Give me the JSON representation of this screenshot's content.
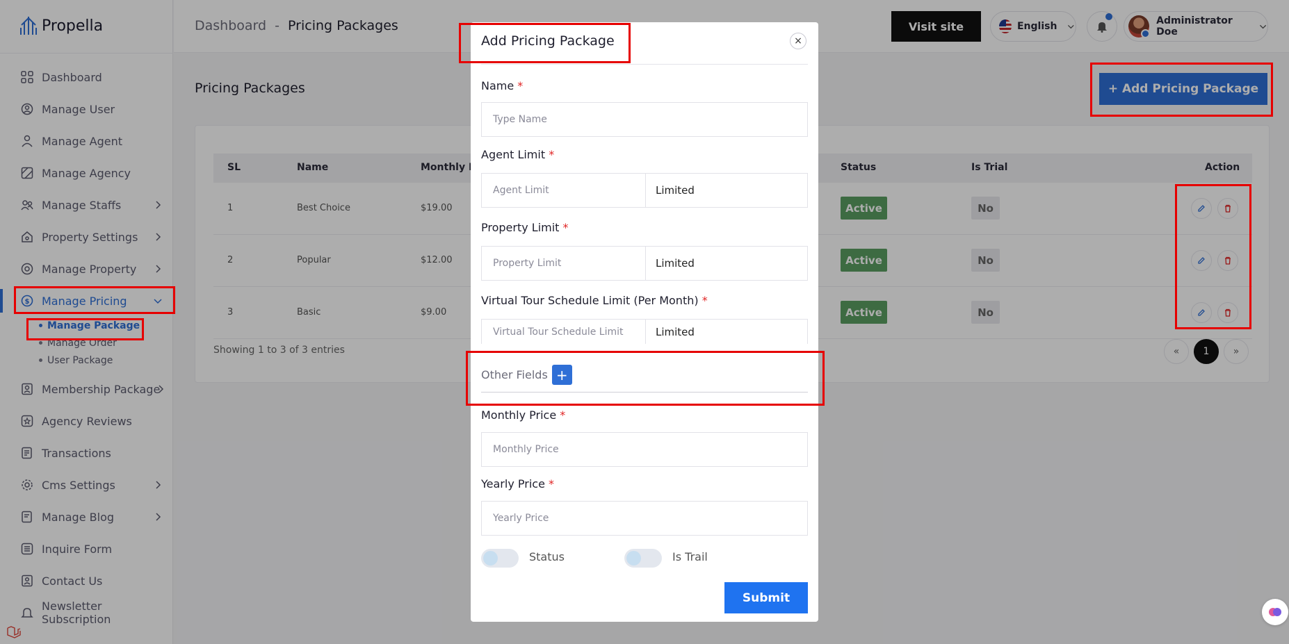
{
  "brand": {
    "name": "Propella"
  },
  "sidebar": {
    "items": [
      {
        "label": "Dashboard",
        "icon": "grid-icon"
      },
      {
        "label": "Manage User",
        "icon": "user-circle-icon"
      },
      {
        "label": "Manage Agent",
        "icon": "agent-icon"
      },
      {
        "label": "Manage Agency",
        "icon": "agency-icon"
      },
      {
        "label": "Manage Staffs",
        "icon": "staff-icon",
        "has_children": true
      },
      {
        "label": "Property Settings",
        "icon": "home-settings-icon",
        "has_children": true
      },
      {
        "label": "Manage Property",
        "icon": "property-icon",
        "has_children": true
      },
      {
        "label": "Manage Pricing",
        "icon": "pricing-icon",
        "has_children": true,
        "expanded": true
      }
    ],
    "pricing_sub": [
      {
        "label": "Manage Package"
      },
      {
        "label": "Manage Order"
      },
      {
        "label": "User Package"
      }
    ],
    "items_after": [
      {
        "label": "Membership Package",
        "icon": "membership-icon",
        "has_children": true
      },
      {
        "label": "Agency Reviews",
        "icon": "review-icon"
      },
      {
        "label": "Transactions",
        "icon": "transaction-icon"
      },
      {
        "label": "Cms Settings",
        "icon": "cms-icon",
        "has_children": true
      },
      {
        "label": "Manage Blog",
        "icon": "blog-icon",
        "has_children": true
      },
      {
        "label": "Inquire Form",
        "icon": "form-icon"
      },
      {
        "label": "Contact Us",
        "icon": "contact-icon"
      },
      {
        "label": "Newsletter Subscription",
        "icon": "newsletter-icon"
      }
    ]
  },
  "header": {
    "breadcrumb_root": "Dashboard",
    "breadcrumb_sep": "-",
    "breadcrumb_current": "Pricing Packages",
    "visit_site": "Visit site",
    "language": "English",
    "user_name": "Administrator Doe"
  },
  "main": {
    "title": "Pricing Packages",
    "add_button": "+ Add Pricing Package",
    "table": {
      "headers": {
        "sl": "SL",
        "name": "Name",
        "monthly": "Monthly Pr",
        "status": "Status",
        "trial": "Is Trial",
        "action": "Action"
      },
      "rows": [
        {
          "sl": "1",
          "name": "Best Choice",
          "monthly": "$19.00",
          "status": "Active",
          "trial": "No"
        },
        {
          "sl": "2",
          "name": "Popular",
          "monthly": "$12.00",
          "status": "Active",
          "trial": "No"
        },
        {
          "sl": "3",
          "name": "Basic",
          "monthly": "$9.00",
          "status": "Active",
          "trial": "No"
        }
      ]
    },
    "showing": "Showing 1 to 3 of 3 entries",
    "pagination": {
      "prev": "«",
      "current": "1",
      "next": "»"
    }
  },
  "modal": {
    "title": "Add Pricing Package",
    "close": "×",
    "required_mark": "*",
    "name_label": "Name",
    "name_placeholder": "Type Name",
    "agent_label": "Agent Limit",
    "agent_placeholder": "Agent Limit",
    "agent_type": "Limited",
    "property_label": "Property Limit",
    "property_placeholder": "Property Limit",
    "property_type": "Limited",
    "tour_label": "Virtual Tour Schedule Limit (Per Month)",
    "tour_placeholder": "Virtual Tour Schedule Limit",
    "tour_type": "Limited",
    "other_fields": "Other Fields",
    "plus": "+",
    "monthly_label": "Monthly Price",
    "monthly_placeholder": "Monthly Price",
    "yearly_label": "Yearly Price",
    "yearly_placeholder": "Yearly Price",
    "status_label": "Status",
    "trial_label": "Is Trail",
    "submit": "Submit"
  },
  "colors": {
    "accent": "#2f6fd6",
    "active_badge": "#5a9e62",
    "highlight": "#e60000"
  }
}
